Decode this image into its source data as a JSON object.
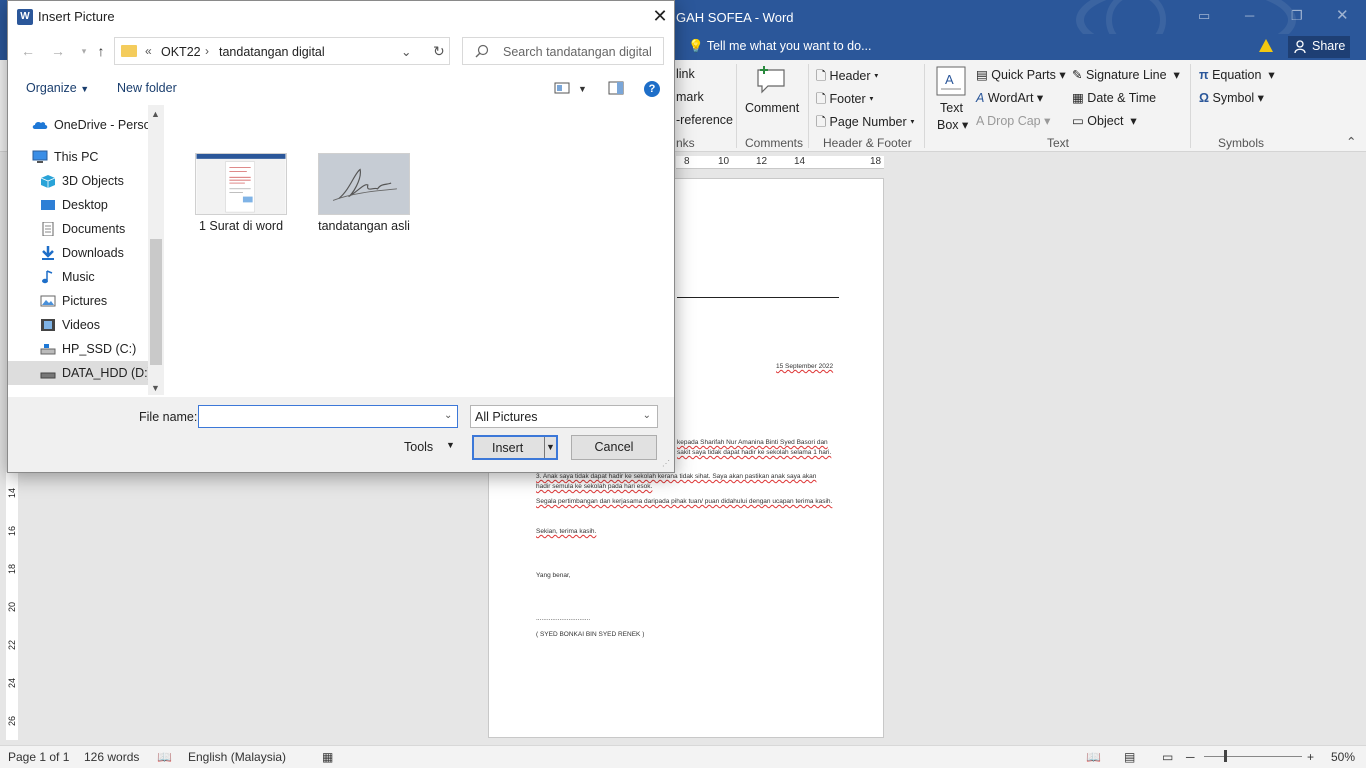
{
  "word": {
    "doc_title": "GAH SOFEA - Word",
    "tell_me": "Tell me what you want to do...",
    "share": "Share",
    "ribbon": {
      "links_partial": [
        "link",
        "mark",
        "-reference"
      ],
      "links_group_partial": "nks",
      "comment": "Comment",
      "comments_group": "Comments",
      "header": "Header",
      "footer": "Footer",
      "page_number": "Page Number",
      "header_footer_group": "Header & Footer",
      "text_box_line1": "Text",
      "text_box_line2": "Box",
      "quick_parts": "Quick Parts",
      "wordart": "WordArt",
      "drop_cap": "Drop Cap",
      "signature_line": "Signature Line",
      "date_time": "Date & Time",
      "object": "Object",
      "text_group": "Text",
      "equation": "Equation",
      "symbol": "Symbol",
      "symbols_group": "Symbols"
    },
    "hruler_ticks": [
      "8",
      "10",
      "12",
      "14",
      "18"
    ],
    "vruler_ticks": [
      "14",
      "16",
      "18",
      "20",
      "22",
      "24",
      "26"
    ],
    "doc_lines": {
      "date": "15 September 2022",
      "line1": "kepada Sharifah Nur Amanina Binti Syed Basori dan",
      "line1b": "sakit saya tidak dapat hadir ke sekolah selama 1 hari.",
      "line2": "3.         Anak saya tidak dapat hadir ke sekolah kerana tidak sihat. Saya akan pastikan anak saya akan",
      "line2b": "hadir semula ke sekolah pada hari esok.",
      "line3": "Segala pertimbangan dan kerjasama daripada pihak tuan/ puan didahului dengan ucapan terima kasih.",
      "line4": "Sekian, terima kasih.",
      "line5": "Yang benar,",
      "line6": "..............................",
      "line7": "( SYED BONKAI BIN SYED RENEK )"
    },
    "status": {
      "page": "Page 1 of 1",
      "words": "126 words",
      "language": "English (Malaysia)",
      "zoom": "50%"
    }
  },
  "dialog": {
    "title": "Insert Picture",
    "close": "✕",
    "breadcrumb": {
      "prefix": "«",
      "items": [
        "OKT22",
        "tandatangan digital"
      ]
    },
    "search_placeholder": "Search tandatangan digital",
    "organize": "Organize",
    "new_folder": "New folder",
    "help": "?",
    "nav_items": [
      {
        "label": "OneDrive - Personal",
        "icon": "onedrive-icon"
      },
      {
        "label": "This PC",
        "icon": "computer-icon"
      },
      {
        "label": "3D Objects",
        "icon": "3d-objects-icon"
      },
      {
        "label": "Desktop",
        "icon": "desktop-icon"
      },
      {
        "label": "Documents",
        "icon": "documents-icon"
      },
      {
        "label": "Downloads",
        "icon": "downloads-icon"
      },
      {
        "label": "Music",
        "icon": "music-icon"
      },
      {
        "label": "Pictures",
        "icon": "pictures-icon"
      },
      {
        "label": "Videos",
        "icon": "videos-icon"
      },
      {
        "label": "HP_SSD (C:)",
        "icon": "drive-icon"
      },
      {
        "label": "DATA_HDD (D:)",
        "icon": "drive-icon"
      }
    ],
    "files": [
      {
        "name": "1 Surat di word"
      },
      {
        "name": "tandatangan asli"
      }
    ],
    "file_name_label": "File name:",
    "file_name_value": "",
    "file_type": "All Pictures",
    "tools": "Tools",
    "insert": "Insert",
    "cancel": "Cancel"
  }
}
